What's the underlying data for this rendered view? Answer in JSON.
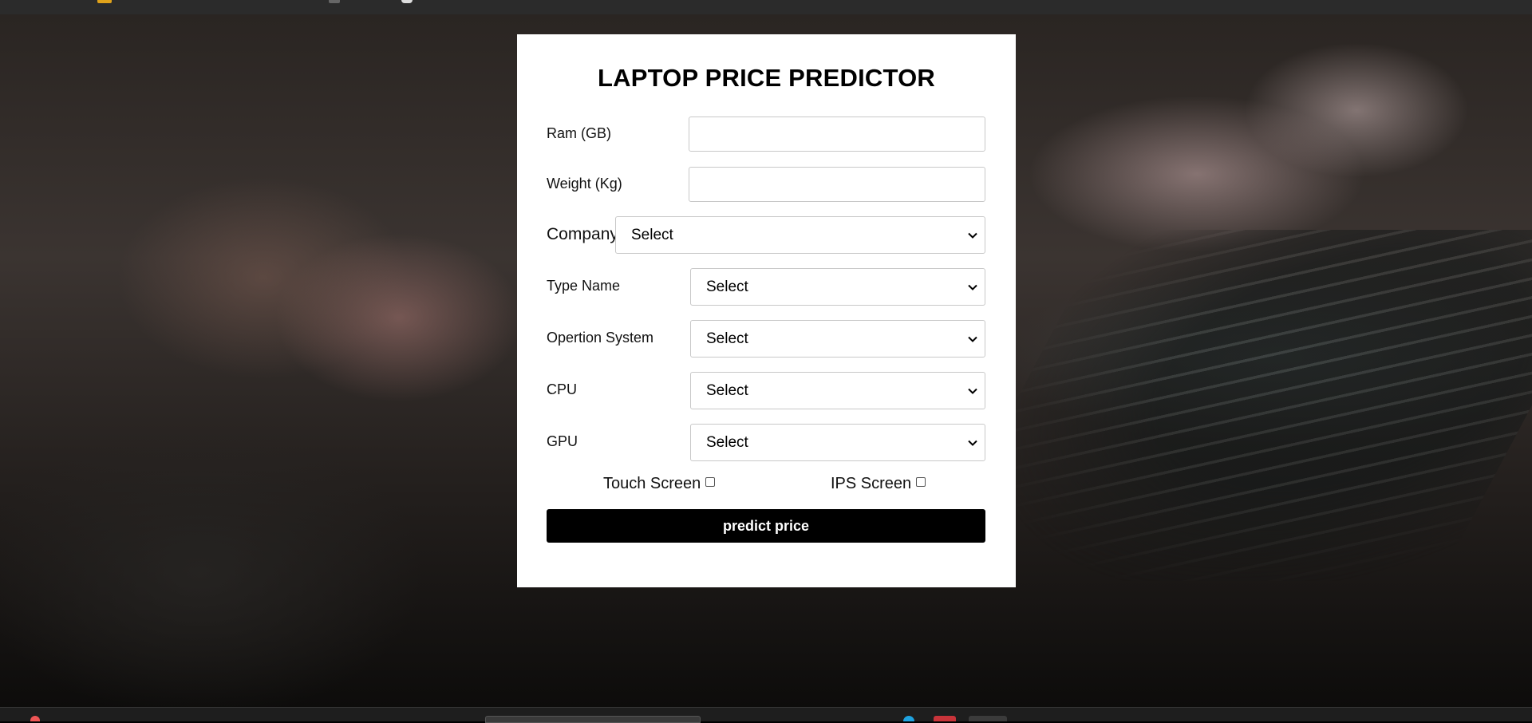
{
  "form": {
    "title": "LAPTOP PRICE PREDICTOR",
    "ram": {
      "label": "Ram (GB)",
      "value": "",
      "placeholder": ""
    },
    "weight": {
      "label": "Weight (Kg)",
      "value": "",
      "placeholder": ""
    },
    "company": {
      "label": "Company",
      "selected": "Select"
    },
    "type_name": {
      "label": "Type Name",
      "selected": "Select"
    },
    "os": {
      "label": "Opertion System",
      "selected": "Select"
    },
    "cpu": {
      "label": "CPU",
      "selected": "Select"
    },
    "gpu": {
      "label": "GPU",
      "selected": "Select"
    },
    "touch_screen": {
      "label": "Touch Screen",
      "checked": false
    },
    "ips_screen": {
      "label": "IPS Screen",
      "checked": false
    },
    "submit_label": "predict price"
  },
  "colors": {
    "card_background": "#ffffff",
    "button_background": "#000000",
    "button_text": "#ffffff",
    "browser_bar": "#2b2b2b"
  }
}
